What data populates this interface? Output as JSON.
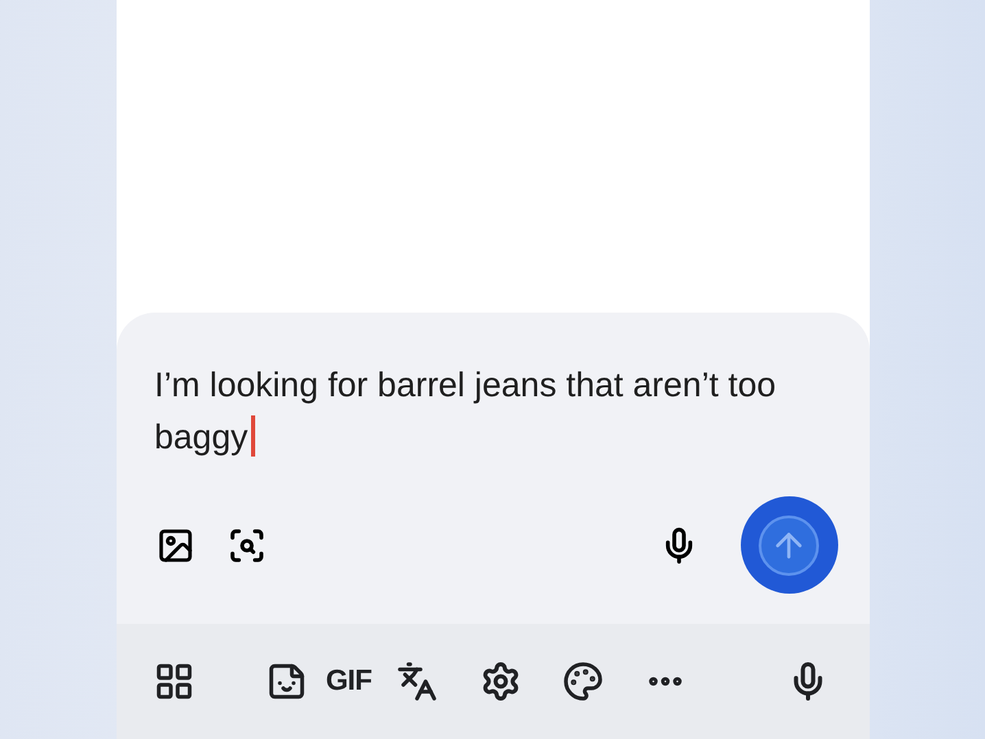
{
  "composer": {
    "value": "I’m looking for barrel jeans that aren’t too baggy"
  },
  "keyboard_toolbar": {
    "gif_label": "GIF"
  }
}
